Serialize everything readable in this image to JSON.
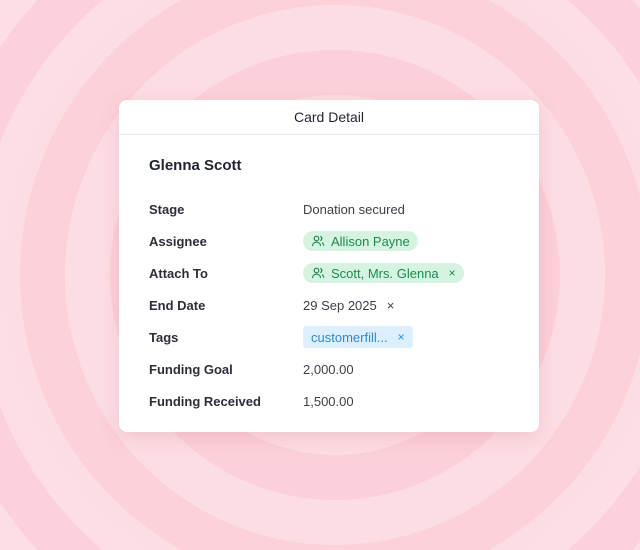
{
  "card": {
    "title": "Card Detail",
    "contact_name": "Glenna Scott"
  },
  "fields": {
    "stage": {
      "label": "Stage",
      "value": "Donation secured"
    },
    "assignee": {
      "label": "Assignee",
      "value": "Allison Payne"
    },
    "attach_to": {
      "label": "Attach To",
      "value": "Scott, Mrs. Glenna",
      "remove": "×"
    },
    "end_date": {
      "label": "End Date",
      "value": "29 Sep 2025",
      "remove": "×"
    },
    "tags": {
      "label": "Tags",
      "value": "customerfill...",
      "remove": "×"
    },
    "funding_goal": {
      "label": "Funding Goal",
      "value": "2,000.00"
    },
    "funding_received": {
      "label": "Funding Received",
      "value": "1,500.00"
    }
  },
  "icons": {
    "assignee": "user-icon",
    "attach_to": "user-icon"
  },
  "colors": {
    "background": "#fccfd9",
    "chip_green_bg": "#d6f3e1",
    "chip_green_text": "#1d8a4e",
    "chip_blue_bg": "#dcefff",
    "chip_blue_text": "#2f8bd0"
  }
}
